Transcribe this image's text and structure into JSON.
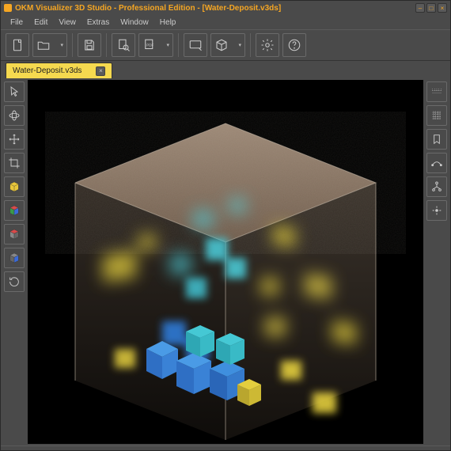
{
  "title": "OKM Visualizer 3D Studio - Professional Edition - [Water-Deposit.v3ds]",
  "window_controls": {
    "min": "–",
    "max": "□",
    "close": "×"
  },
  "menu": {
    "items": [
      "File",
      "Edit",
      "View",
      "Extras",
      "Window",
      "Help"
    ]
  },
  "toolbar": {
    "new": "new-file-icon",
    "open": "open-folder-icon",
    "save": "save-icon",
    "zoomdoc": "zoom-document-icon",
    "pdf": "export-pdf-icon",
    "screenshot": "screenshot-icon",
    "cube3d": "3d-cube-icon",
    "settings": "gear-icon",
    "help": "help-icon"
  },
  "tabs": [
    {
      "label": "Water-Deposit.v3ds"
    }
  ],
  "left_tools": [
    "pointer",
    "orbit",
    "pan",
    "crop",
    "cube-y",
    "cube-rgb",
    "cube-red",
    "cube-blue",
    "reset-rotation"
  ],
  "right_tools": [
    "grid-top",
    "grid-fine",
    "bookmark",
    "measure",
    "hierarchy",
    "focus-center"
  ]
}
